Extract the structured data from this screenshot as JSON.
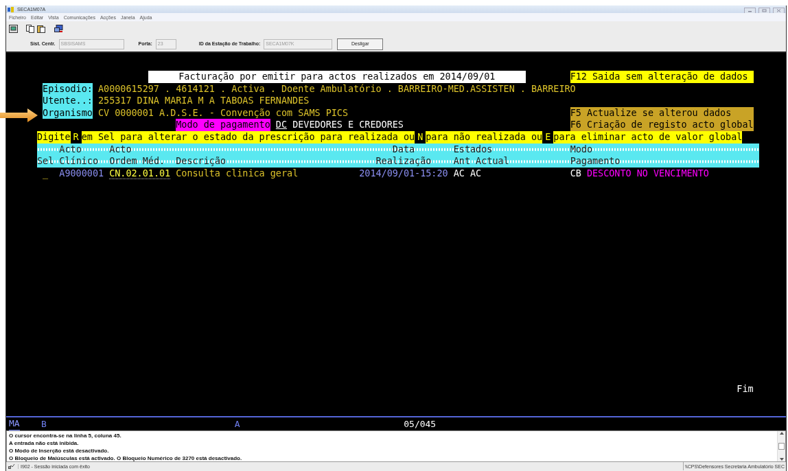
{
  "window": {
    "title": "SECA1M07A"
  },
  "menu": [
    "Ficheiro",
    "Editar",
    "Vista",
    "Comunicações",
    "Acções",
    "Janela",
    "Ajuda"
  ],
  "connection": {
    "host_label": "Sist. Centr.",
    "host": "SBSISAMS",
    "port_label": "Porta:",
    "port": "23",
    "workstation_label": "ID da Estação de Trabalho:",
    "workstation": "SECA1M07K",
    "disconnect_button": "Desligar"
  },
  "terminal": {
    "title": "Facturação por emitir para actos realizados em 2014/09/01",
    "function_keys": [
      {
        "text": "F12 Saida sem alteração de dados",
        "kind": "exit"
      },
      {
        "text": "F5 Actualize se alterou dados",
        "kind": "action"
      },
      {
        "text": "F6 Criação de registo acto global",
        "kind": "action"
      }
    ],
    "fields": [
      {
        "label": "Episodio:",
        "value": "A0000615297 . 4614121 . Activa . Doente Ambulatório . BARREIRO-MED.ASSISTEN . BARREIRO"
      },
      {
        "label": "Utente..:",
        "value": "255317 DINA MARIA M A TABOAS FERNANDES"
      },
      {
        "label": "Organismo",
        "value": "CV 0000001 A.D.S.E. - Convenção com SAMS PICS"
      }
    ],
    "payment_mode": {
      "label": "Modo de pagamento",
      "code": "DC",
      "description": "DEVEDORES E CREDORES"
    },
    "instruction": [
      {
        "kind": "text",
        "text": "Digite"
      },
      {
        "kind": "key",
        "text": "R"
      },
      {
        "kind": "text",
        "text": "em Sel para alterar o estado da prescrição para realizada ou"
      },
      {
        "kind": "key",
        "text": "N"
      },
      {
        "kind": "text",
        "text": "para não realizada ou"
      },
      {
        "kind": "key",
        "text": "E"
      },
      {
        "kind": "text",
        "text": "para eliminar acto de valor global"
      }
    ],
    "columns": [
      {
        "line2": "Sel"
      },
      {
        "line1": "Acto",
        "line2": "Clínico"
      },
      {
        "line1": "Acto",
        "line2": "Ordem Méd."
      },
      {
        "line2": "Descrição"
      },
      {
        "line1": "Data",
        "line2": "Realização"
      },
      {
        "line1": "Estados",
        "line2": "Ant Actual"
      },
      {
        "line1": "Modo",
        "line2": "Pagamento"
      }
    ],
    "rows": [
      {
        "sel": "_",
        "acto_clinico": "A9000001",
        "acto_ordem": "CN.02.01.01",
        "descricao": "Consulta clinica geral",
        "data": "2014/09/01-15:20",
        "estado_ant": "AC",
        "estado_actual": "AC",
        "modo": "CB",
        "modo_descricao": "DESCONTO NO VENCIMENTO"
      }
    ],
    "end_marker": "Fim"
  },
  "operator_info": {
    "mode": "MA",
    "indicator_1": "B",
    "indicator_2": "A",
    "cursor_position": "05/045"
  },
  "messages": [
    "O cursor encontra-se na linha 5, coluna 45.",
    "A entrada não está inibida.",
    "O Modo de Inserção está desactivado.",
    "O Bloqueio de Maiúsculas está activado. O Bloqueio Numérico de 3270 está desactivado."
  ],
  "status_bar": {
    "message": "I902 - Sessão iniciada com êxito",
    "session": "\\\\CPS\\Defensores Secretaria Ambulatório SEC"
  }
}
